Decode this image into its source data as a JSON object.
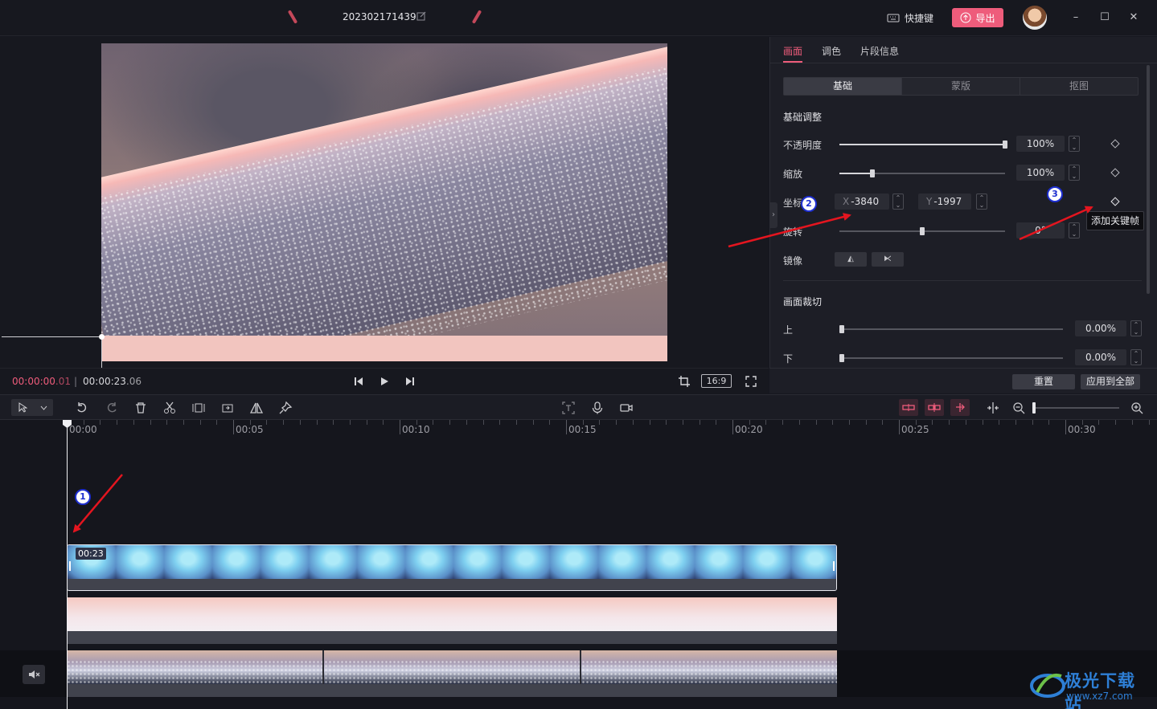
{
  "titlebar": {
    "project_name": "202302171439",
    "shortcut_label": "快捷键",
    "export_label": "导出",
    "window_controls": [
      "minimize-icon",
      "maximize-icon",
      "close-icon"
    ]
  },
  "preview": {
    "time_current": "00:00:00",
    "time_current_frames": ".01",
    "time_total": "00:00:23",
    "time_total_frames": ".06",
    "ratio": "16:9"
  },
  "panel": {
    "tabs": [
      "画面",
      "调色",
      "片段信息"
    ],
    "active_tab": "画面",
    "segments": [
      "基础",
      "蒙版",
      "抠图"
    ],
    "active_segment": "基础",
    "basic_title": "基础调整",
    "opacity_label": "不透明度",
    "opacity_value": "100%",
    "opacity_level": 1.0,
    "scale_label": "缩放",
    "scale_value": "100%",
    "scale_level": 0.2,
    "position_label": "坐标",
    "position_x_axis": "X",
    "position_x": "-3840",
    "position_y_axis": "Y",
    "position_y": "-1997",
    "rotation_label": "旋转",
    "rotation_value": "0°",
    "rotation_level": 0.5,
    "mirror_label": "镜像",
    "keyframe_tooltip": "添加关键帧",
    "crop_title": "画面裁切",
    "crop_top_label": "上",
    "crop_top_value": "0.00%",
    "crop_bottom_label": "下",
    "crop_bottom_value": "0.00%",
    "reset_label": "重置",
    "apply_all_label": "应用到全部"
  },
  "timeline": {
    "ruler_labels": [
      "00:00",
      "00:05",
      "00:10",
      "00:15",
      "00:20",
      "00:25",
      "00:30"
    ],
    "clip_duration": "00:23"
  },
  "annotations": [
    "1",
    "2",
    "3"
  ],
  "watermark": {
    "title": "极光下载站",
    "url": "www.xz7.com"
  },
  "colors": {
    "accent": "#ee5c7b",
    "arrow": "#e4151f",
    "annotation": "#1e2fd0"
  }
}
